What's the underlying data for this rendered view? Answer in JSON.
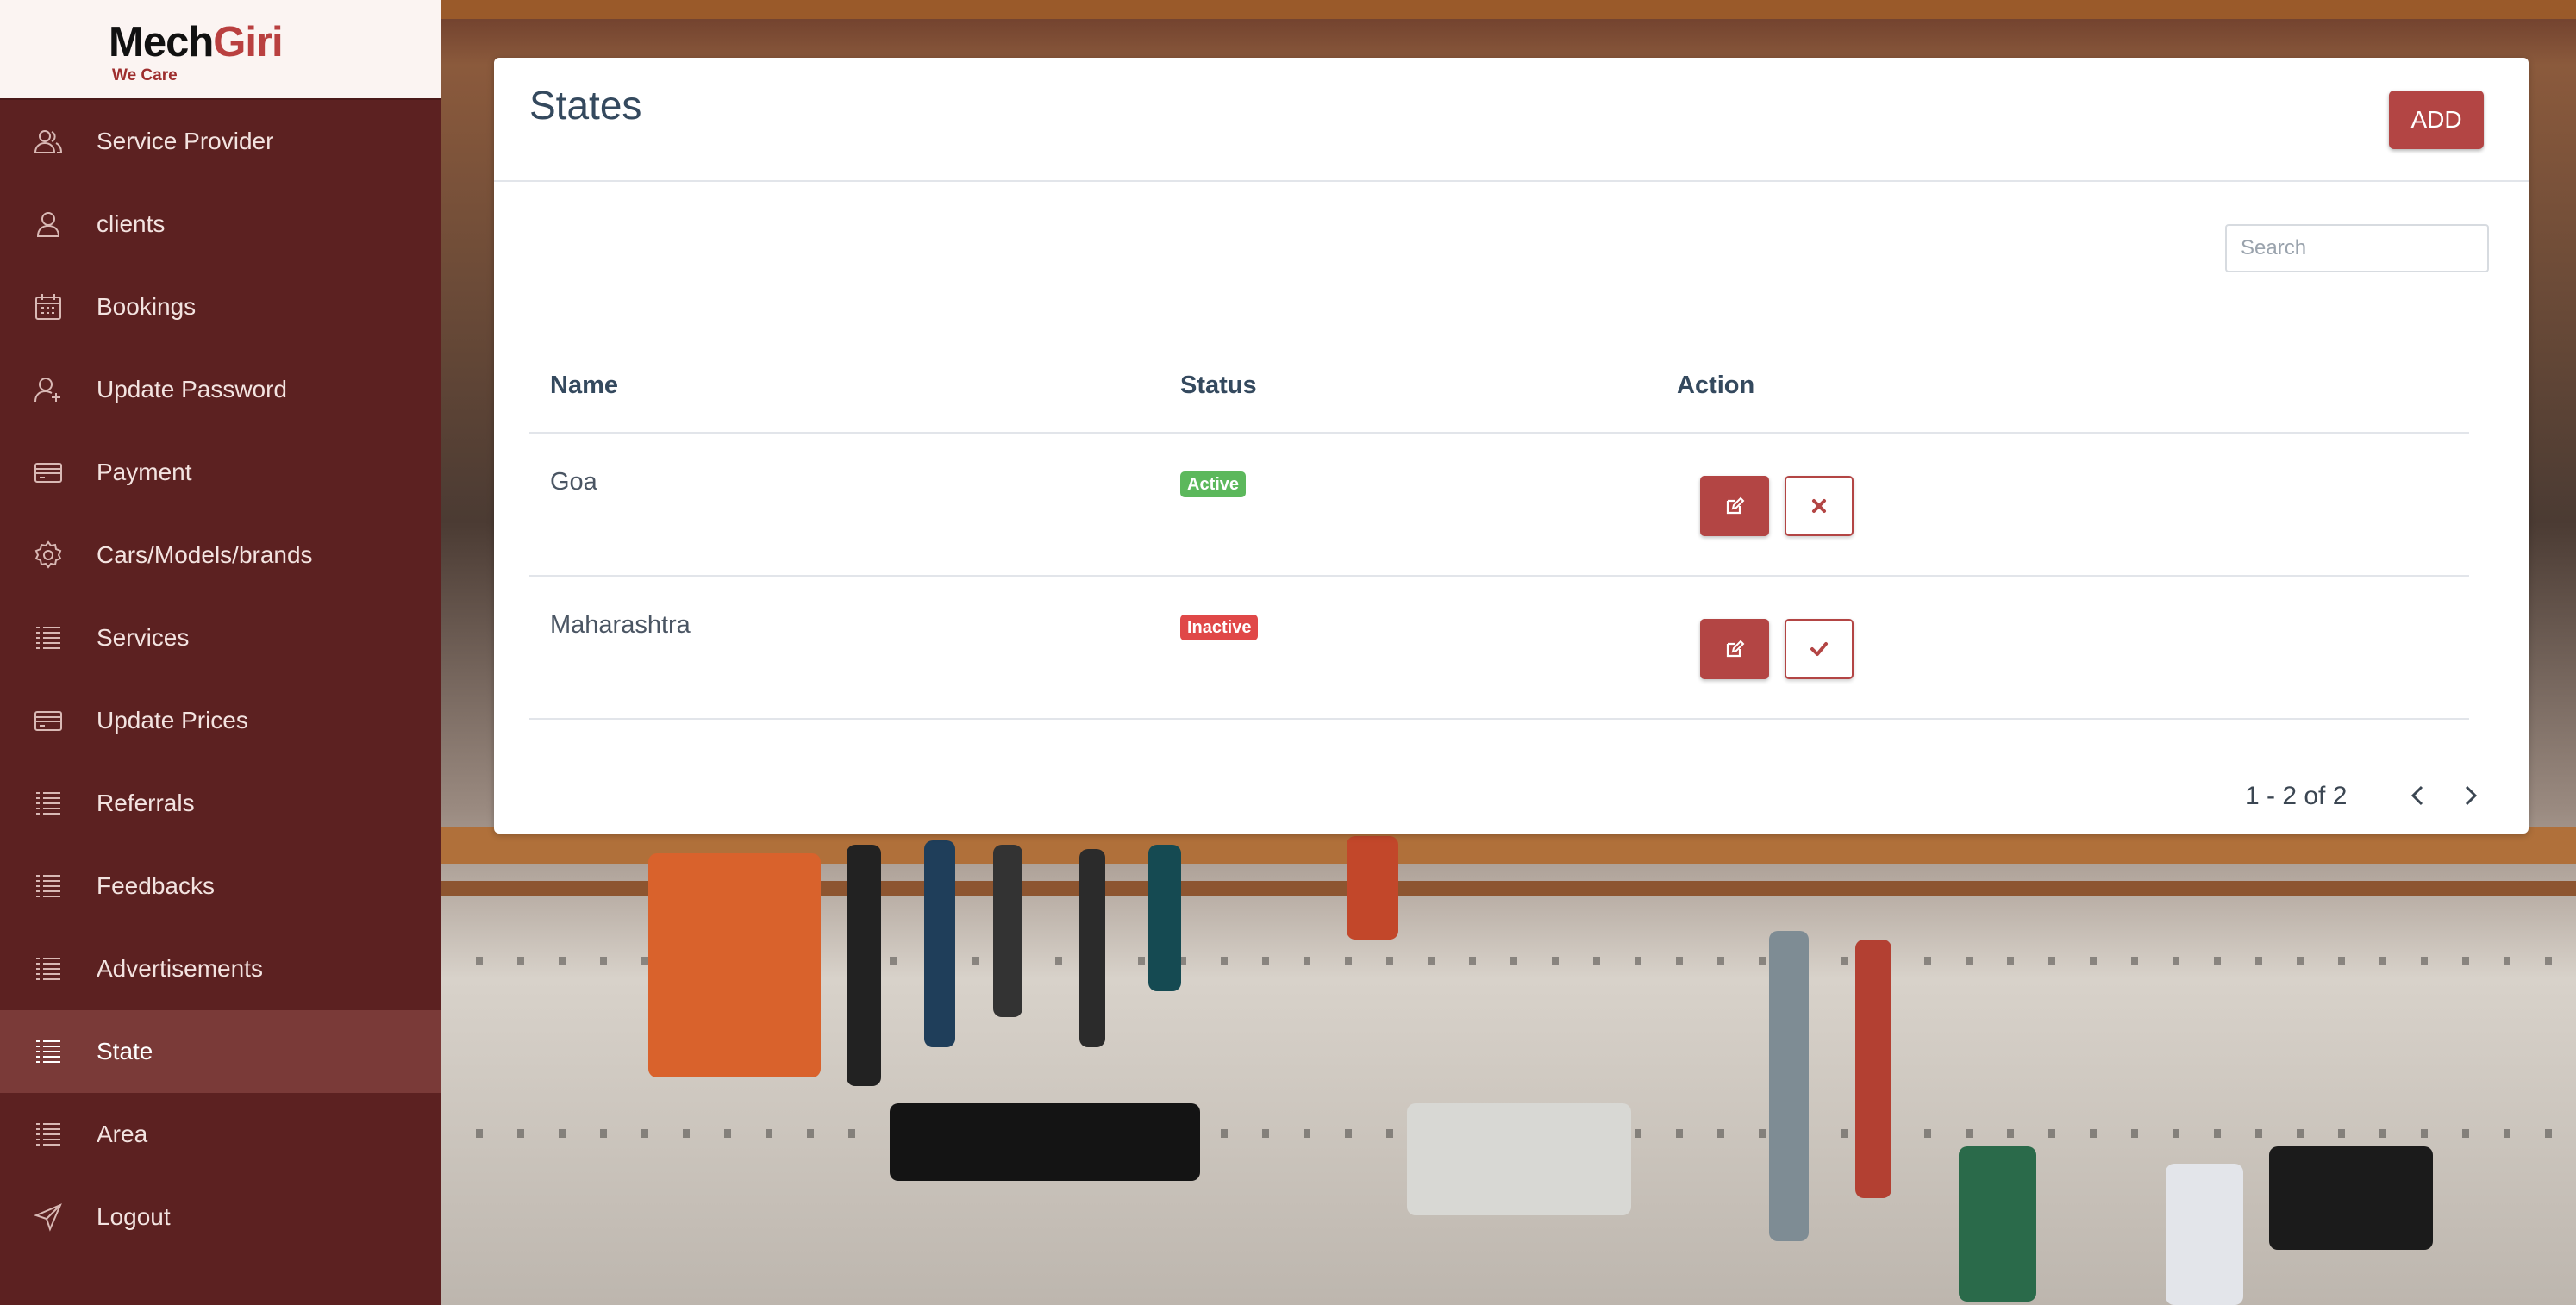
{
  "brand": {
    "name_part1": "Mech",
    "name_part2": "Giri",
    "tagline": "We Care"
  },
  "sidebar": {
    "items": [
      {
        "label": "Service Provider",
        "icon": "users-icon"
      },
      {
        "label": "clients",
        "icon": "user-icon"
      },
      {
        "label": "Bookings",
        "icon": "calendar-icon"
      },
      {
        "label": "Update Password",
        "icon": "user-plus-icon"
      },
      {
        "label": "Payment",
        "icon": "credit-card-icon"
      },
      {
        "label": "Cars/Models/brands",
        "icon": "gear-icon"
      },
      {
        "label": "Services",
        "icon": "list-icon"
      },
      {
        "label": "Update Prices",
        "icon": "credit-card-icon"
      },
      {
        "label": "Referrals",
        "icon": "list-icon"
      },
      {
        "label": "Feedbacks",
        "icon": "list-icon"
      },
      {
        "label": "Advertisements",
        "icon": "list-icon"
      },
      {
        "label": "State",
        "icon": "list-icon",
        "active": true
      },
      {
        "label": "Area",
        "icon": "list-icon"
      },
      {
        "label": "Logout",
        "icon": "send-icon"
      }
    ]
  },
  "page": {
    "title": "States",
    "add_label": "ADD",
    "search_placeholder": "Search"
  },
  "table": {
    "columns": [
      "Name",
      "Status",
      "Action"
    ],
    "rows": [
      {
        "name": "Goa",
        "status": "Active",
        "status_color": "#5cb85c",
        "toggle_icon": "close-icon"
      },
      {
        "name": "Maharashtra",
        "status": "Inactive",
        "status_color": "#e04848",
        "toggle_icon": "check-icon"
      }
    ]
  },
  "pagination": {
    "text": "1 - 2 of 2"
  },
  "colors": {
    "sidebar": "#5c2121",
    "accent": "#b34544",
    "active_item": "#7a3a38"
  }
}
